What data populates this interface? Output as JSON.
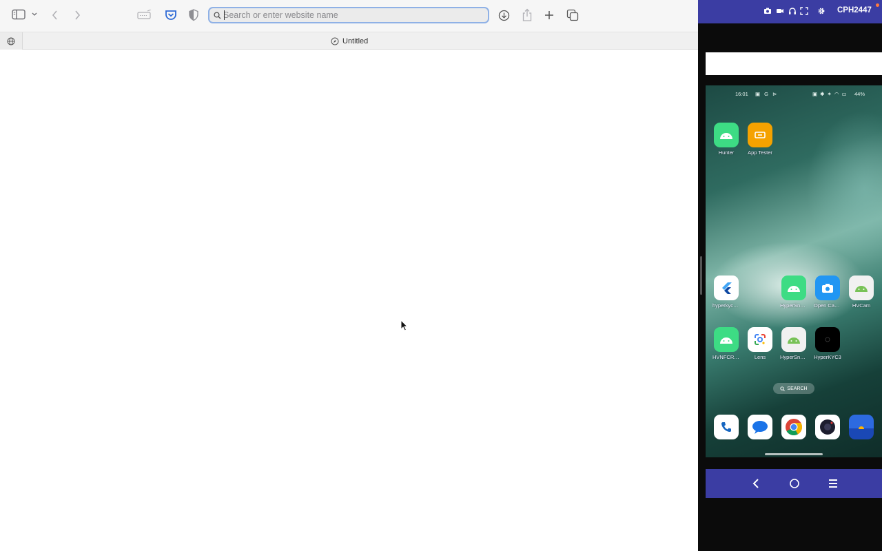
{
  "safari": {
    "address_bar": {
      "placeholder": "Search or enter website name",
      "value": ""
    },
    "tab": {
      "title": "Untitled"
    }
  },
  "mirror": {
    "device_name": "CPH2447",
    "status_bar": {
      "time": "16:01",
      "battery": "44%"
    },
    "apps_top": [
      {
        "label": "Hunter",
        "icon": "android-icon",
        "color": "#3ddc84"
      },
      {
        "label": "App Tester",
        "icon": "app-tester-icon",
        "color": "#f5a200"
      }
    ],
    "apps_row2": [
      {
        "label": "hyperkyc_fl...",
        "icon": "flutter-icon",
        "color": "#ffffff"
      },
      {
        "label": "HyperSnap...",
        "icon": "android-icon",
        "color": "#3ddc84"
      },
      {
        "label": "Open Cam...",
        "icon": "camera-icon",
        "color": "#2196f3"
      },
      {
        "label": "HVCam",
        "icon": "android-icon",
        "color": "#f1f1f1"
      }
    ],
    "apps_row3": [
      {
        "label": "HVNFCRe...",
        "icon": "android-icon",
        "color": "#3ddc84"
      },
      {
        "label": "Lens",
        "icon": "lens-icon",
        "color": "#ffffff"
      },
      {
        "label": "HyperSnap...",
        "icon": "android-icon",
        "color": "#f1f1f1"
      },
      {
        "label": "HyperKYC3",
        "icon": "hyperkyc-icon",
        "color": "#000000"
      }
    ],
    "search_label": "SEARCH",
    "dock": [
      {
        "name": "phone-app-icon",
        "color": "#ffffff"
      },
      {
        "name": "messages-app-icon",
        "color": "#ffffff"
      },
      {
        "name": "chrome-app-icon",
        "color": "#ffffff"
      },
      {
        "name": "camera-app-icon",
        "color": "#ffffff"
      },
      {
        "name": "photos-app-icon",
        "color": "#2d6ae0"
      }
    ],
    "colors": {
      "bar": "#3b3da3"
    }
  }
}
